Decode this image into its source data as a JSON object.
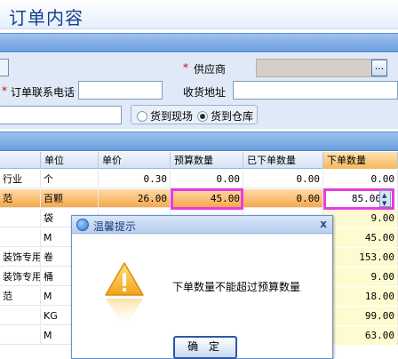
{
  "title": "订单内容",
  "form": {
    "supplier_label": "供应商",
    "supplier_value": "",
    "supplier_button": "...",
    "order_phone_label": "订单联系电话",
    "order_phone_value": "",
    "delivery_address_label": "收货地址",
    "delivery_address_value": "",
    "extra_input_value": "",
    "required_star": "*",
    "radio_site": "货到现场",
    "radio_warehouse": "货到仓库",
    "radio_selected": "货到仓库"
  },
  "grid": {
    "columns": [
      "",
      "单位",
      "单价",
      "预算数量",
      "已下单数量",
      "下单数量"
    ],
    "rows": [
      {
        "name": "行业",
        "unit": "个",
        "price": "0.30",
        "budget": "0.00",
        "ordered": "0.00",
        "qty": "0.00",
        "selected": false
      },
      {
        "name": "范",
        "unit": "百颗",
        "price": "26.00",
        "budget": "45.00",
        "ordered": "0.00",
        "qty": "85.00",
        "selected": true
      },
      {
        "name": "",
        "unit": "袋",
        "price": "",
        "budget": "",
        "ordered": "",
        "qty": "9.00",
        "selected": false
      },
      {
        "name": "",
        "unit": "M",
        "price": "",
        "budget": "",
        "ordered": "",
        "qty": "45.00",
        "selected": false
      },
      {
        "name": "装饰专用",
        "unit": "卷",
        "price": "",
        "budget": "",
        "ordered": "",
        "qty": "153.00",
        "selected": false
      },
      {
        "name": "装饰专用",
        "unit": "桶",
        "price": "",
        "budget": "",
        "ordered": "",
        "qty": "9.00",
        "selected": false
      },
      {
        "name": "范",
        "unit": "M",
        "price": "",
        "budget": "",
        "ordered": "",
        "qty": "18.00",
        "selected": false
      },
      {
        "name": "",
        "unit": "KG",
        "price": "",
        "budget": "",
        "ordered": "",
        "qty": "99.00",
        "selected": false
      },
      {
        "name": "",
        "unit": "M",
        "price": "",
        "budget": "",
        "ordered": "",
        "qty": "63.00",
        "selected": false
      }
    ]
  },
  "dialog": {
    "title": "温馨提示",
    "close": "x",
    "message": "下单数量不能超过预算数量",
    "ok_label": "确 定",
    "icon": "warning-icon"
  },
  "colors": {
    "selected_row": "#f7a84c",
    "highlight": "#e83ce0",
    "qty_column": "#fffbd0"
  }
}
